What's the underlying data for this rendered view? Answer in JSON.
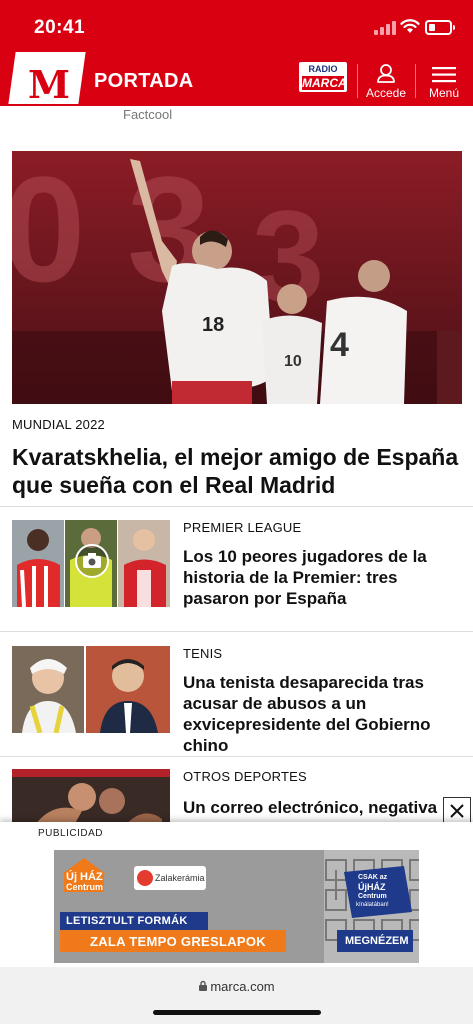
{
  "status_bar": {
    "time": "20:41"
  },
  "header": {
    "logo_letter": "M",
    "section_title": "PORTADA",
    "radio_line1": "RADIO",
    "radio_line2": "MARCA",
    "account_label": "Accede",
    "menu_label": "Menú"
  },
  "previous_item": {
    "source": "Factcool"
  },
  "hero": {
    "kicker": "MUNDIAL 2022",
    "title": "Kvaratskhelia, el mejor amigo de España que sueña con el Real Madrid",
    "jersey_numbers": [
      "18",
      "10",
      "4"
    ]
  },
  "articles": [
    {
      "kicker": "PREMIER LEAGUE",
      "title": "Los 10 peores jugadores de la historia de la Premier: tres pasaron por España",
      "icon": "camera-icon"
    },
    {
      "kicker": "TENIS",
      "title": "Una tenista desaparecida tras acusar de abusos a un exvicepresidente del Gobierno chino"
    },
    {
      "kicker": "OTROS DEPORTES",
      "title": "Un correo electrónico, negativa"
    }
  ],
  "ad": {
    "label": "PUBLICIDAD",
    "brand1_line1": "Új HÁZ",
    "brand1_line2": "Centrum",
    "brand2": "Zalakerámia",
    "headline1": "LETISZTULT FORMÁK",
    "headline2": "ZALA TEMPO GRESLAPOK",
    "badge_line1": "CSAK az",
    "badge_line2": "ÚjHÁZ",
    "badge_line3": "Centrum",
    "badge_line4": "kínálatában!",
    "cta": "MEGNÉZEM"
  },
  "browser": {
    "url": "marca.com"
  },
  "colors": {
    "brand": "#d90012",
    "ad_orange": "#f07a1a",
    "ad_navy": "#1f3a8a"
  }
}
